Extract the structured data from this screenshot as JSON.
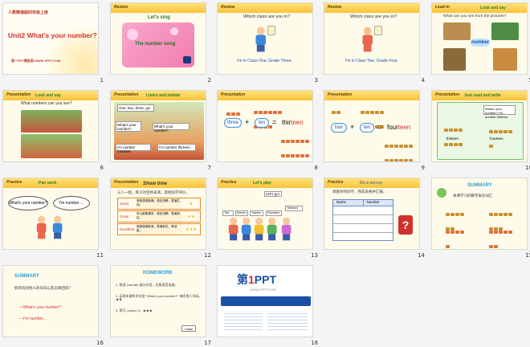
{
  "slides": [
    {
      "number": "1",
      "title": "人教精通版四年级上册",
      "subtitle": "Unit2 What's your number?",
      "footer": "第一PPT模板网-WWW.1PPT.COM"
    },
    {
      "number": "2",
      "tag": "Review",
      "heading": "Let's sing",
      "song": "The number song"
    },
    {
      "number": "3",
      "tag": "Review",
      "question": "Which class are you in?",
      "answer": "I'm in Class One, Grade Three."
    },
    {
      "number": "4",
      "tag": "Review",
      "question": "Which class are you in?",
      "answer": "I'm in Class Two, Grade Four."
    },
    {
      "number": "5",
      "tag": "Lead-in",
      "heading": "Look and say",
      "question": "What can you see from the pictures?",
      "callout": "number"
    },
    {
      "number": "6",
      "tag": "Presentation",
      "heading": "Look and say",
      "question": "What numbers can you see?"
    },
    {
      "number": "7",
      "tag": "Presentation",
      "heading": "Listen and imitate",
      "bubble1": "One, two, three, go!",
      "bubble2": "What's your number?",
      "bubble3": "What's your number?",
      "reply1": "I'm number fourteen.",
      "reply2": "I'm number thirteen."
    },
    {
      "number": "8",
      "tag": "Presentation",
      "word1": "three",
      "op": "+",
      "word2": "ten",
      "eq": "=",
      "result_prefix": "thir",
      "result_suffix": "teen"
    },
    {
      "number": "9",
      "tag": "Presentation",
      "word1": "four",
      "op": "+",
      "word2": "ten",
      "eq": "=",
      "result_prefix": "four",
      "result_suffix": "teen"
    },
    {
      "number": "10",
      "tag": "Presentation",
      "heading": "Just read and write",
      "bubble": "What's your number? I'm number thirteen.",
      "label1": "thirteen",
      "label2": "fourteen"
    },
    {
      "number": "11",
      "tag": "Practice",
      "heading": "Pair work",
      "bubble1": "What's your number?",
      "bubble2": "I'm number ..."
    },
    {
      "number": "12",
      "tag": "Presentation",
      "heading": "Show time",
      "intro": "三人一组，练习对话并表演，其他同学评价。",
      "rows": [
        {
          "level": "Good",
          "desc": "语音语调准确，语言流畅，表演生动。",
          "stars": "★"
        },
        {
          "level": "Great",
          "desc": "可以脱离课本，语言流畅，表演到位。",
          "stars": "★★"
        },
        {
          "level": "Excellent",
          "desc": "语音语调标准，表演到位，有创新。",
          "stars": "★★★"
        }
      ]
    },
    {
      "number": "13",
      "tag": "Practice",
      "heading": "Let's play",
      "bubble1": "Let's go!",
      "labels": [
        "Ten",
        "Eleven",
        "Twelve",
        "Fourteen",
        "Thirteen"
      ]
    },
    {
      "number": "14",
      "tag": "Practice",
      "heading": "Do a survey",
      "intro": "调查你的同学，完成表格并汇报。",
      "col1": "Name",
      "col2": "Number",
      "q": "?"
    },
    {
      "number": "15",
      "tag": "Summary",
      "heading": "SUMMARY",
      "intro": "本课学习的数字表达词汇"
    },
    {
      "number": "16",
      "tag": "Summary",
      "heading": "SUMMARY",
      "intro": "如何询问他人的号码以及怎样回答？",
      "line1": "—What's your number?",
      "line2": "—I'm number..."
    },
    {
      "number": "17",
      "tag": "Homework",
      "heading": "HOMEWORK",
      "item1": "1. 熟读 Just talk 部分对话，注意语音语调。",
      "item2": "2. 运用本课所学句型 \"What's your number?\" 询问他人号码。★★",
      "item3": "3. 预习 Lesson 9。★★★",
      "close": "Close"
    },
    {
      "number": "18",
      "logo_prefix": "第",
      "logo_digit": "1",
      "logo_word": "PPT",
      "tagline": "WWW.1PPT.COM"
    }
  ],
  "colors": {
    "accent": "#f9c33a",
    "red": "#d0312d",
    "blue": "#1b4fa3",
    "pink": "#f27bb0"
  }
}
